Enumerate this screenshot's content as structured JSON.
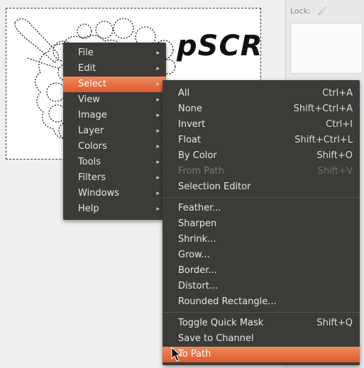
{
  "canvas": {
    "logo_text": "pSCR"
  },
  "dock": {
    "lock_label": "Lock:"
  },
  "main_menu": {
    "items": [
      {
        "label": "File",
        "has_submenu": true
      },
      {
        "label": "Edit",
        "has_submenu": true
      },
      {
        "label": "Select",
        "has_submenu": true,
        "active": true
      },
      {
        "label": "View",
        "has_submenu": true
      },
      {
        "label": "Image",
        "has_submenu": true
      },
      {
        "label": "Layer",
        "has_submenu": true
      },
      {
        "label": "Colors",
        "has_submenu": true
      },
      {
        "label": "Tools",
        "has_submenu": true
      },
      {
        "label": "Filters",
        "has_submenu": true
      },
      {
        "label": "Windows",
        "has_submenu": true
      },
      {
        "label": "Help",
        "has_submenu": true
      }
    ]
  },
  "select_menu": {
    "group1": [
      {
        "label": "All",
        "shortcut": "Ctrl+A"
      },
      {
        "label": "None",
        "shortcut": "Shift+Ctrl+A"
      },
      {
        "label": "Invert",
        "shortcut": "Ctrl+I"
      },
      {
        "label": "Float",
        "shortcut": "Shift+Ctrl+L"
      },
      {
        "label": "By Color",
        "shortcut": "Shift+O"
      },
      {
        "label": "From Path",
        "shortcut": "Shift+V",
        "disabled": true
      },
      {
        "label": "Selection Editor",
        "shortcut": ""
      }
    ],
    "group2": [
      {
        "label": "Feather..."
      },
      {
        "label": "Sharpen"
      },
      {
        "label": "Shrink..."
      },
      {
        "label": "Grow..."
      },
      {
        "label": "Border..."
      },
      {
        "label": "Distort..."
      },
      {
        "label": "Rounded Rectangle..."
      }
    ],
    "group3": [
      {
        "label": "Toggle Quick Mask",
        "shortcut": "Shift+Q"
      },
      {
        "label": "Save to Channel",
        "shortcut": ""
      },
      {
        "label": "To Path",
        "shortcut": "",
        "active": true
      }
    ]
  },
  "colors": {
    "menu_bg": "#3c3b37",
    "accent": "#e76a3b",
    "disabled_text": "#7a7975"
  }
}
